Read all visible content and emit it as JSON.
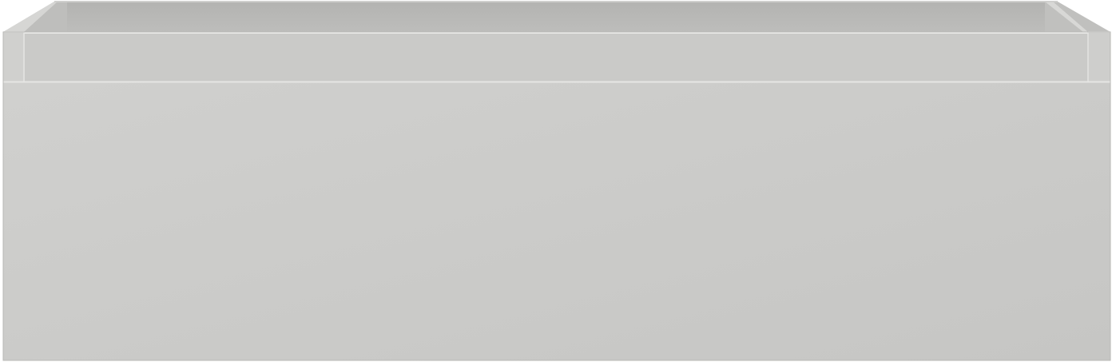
{
  "object": {
    "kind": "drawer-box",
    "colors": {
      "front_light": "#d0d0ce",
      "front_dark": "#c6c6c4",
      "inner_back": "#b5b5b3",
      "inner_side": "#bdbdbb",
      "top_edge": "#dcdcda",
      "rim_line": "#eeeeec",
      "outline": "#a9a9a7"
    }
  }
}
